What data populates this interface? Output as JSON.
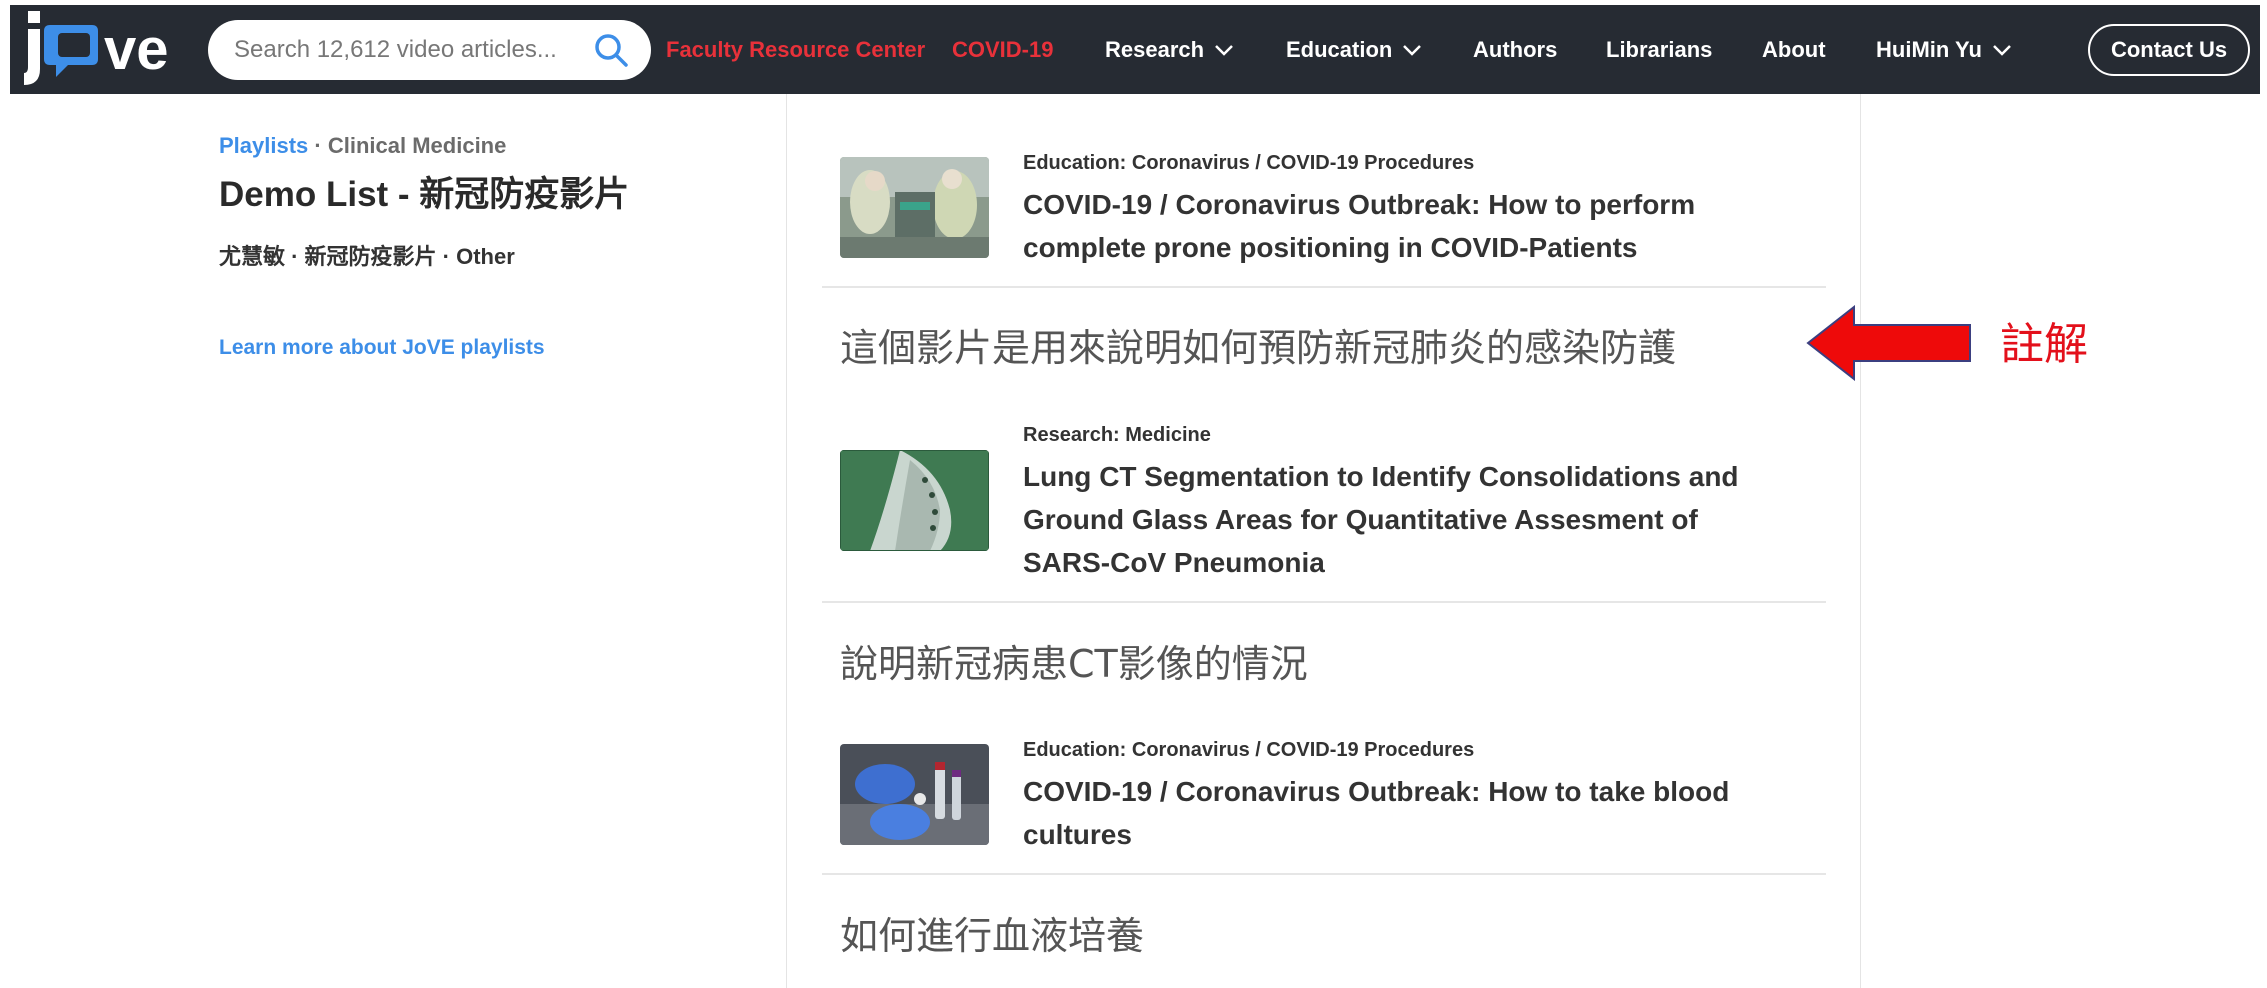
{
  "header": {
    "logo_text": "jove",
    "search_placeholder": "Search 12,612 video articles...",
    "nav": {
      "faculty": "Faculty Resource Center",
      "covid": "COVID-19",
      "research": "Research",
      "education": "Education",
      "authors": "Authors",
      "librarians": "Librarians",
      "about": "About",
      "user": "HuiMin Yu",
      "contact": "Contact Us"
    }
  },
  "playlist": {
    "crumb_link": "Playlists",
    "crumb_sep": "·",
    "crumb_category": "Clinical Medicine",
    "title": "Demo List - 新冠防疫影片",
    "meta": "尤慧敏 · 新冠防疫影片 · Other",
    "learn_more": "Learn more about JoVE playlists"
  },
  "videos": [
    {
      "category": "Education: Coronavirus / COVID-19 Procedures",
      "title": "COVID-19 / Coronavirus Outbreak: How to perform complete prone positioning in COVID-Patients",
      "note": "這個影片是用來說明如何預防新冠肺炎的感染防護"
    },
    {
      "category": "Research: Medicine",
      "title": "Lung CT Segmentation to Identify Consolidations and Ground Glass Areas for Quantitative Assesment of SARS-CoV Pneumonia",
      "note": "說明新冠病患CT影像的情況"
    },
    {
      "category": "Education: Coronavirus / COVID-19 Procedures",
      "title": "COVID-19 / Coronavirus Outbreak: How to take blood cultures",
      "note": "如何進行血液培養"
    }
  ],
  "annotation": {
    "label": "註解"
  },
  "colors": {
    "navbar_bg": "#262b33",
    "accent_red": "#e8313a",
    "link_blue": "#3d8ee8",
    "annotation_red": "#e3101b"
  }
}
